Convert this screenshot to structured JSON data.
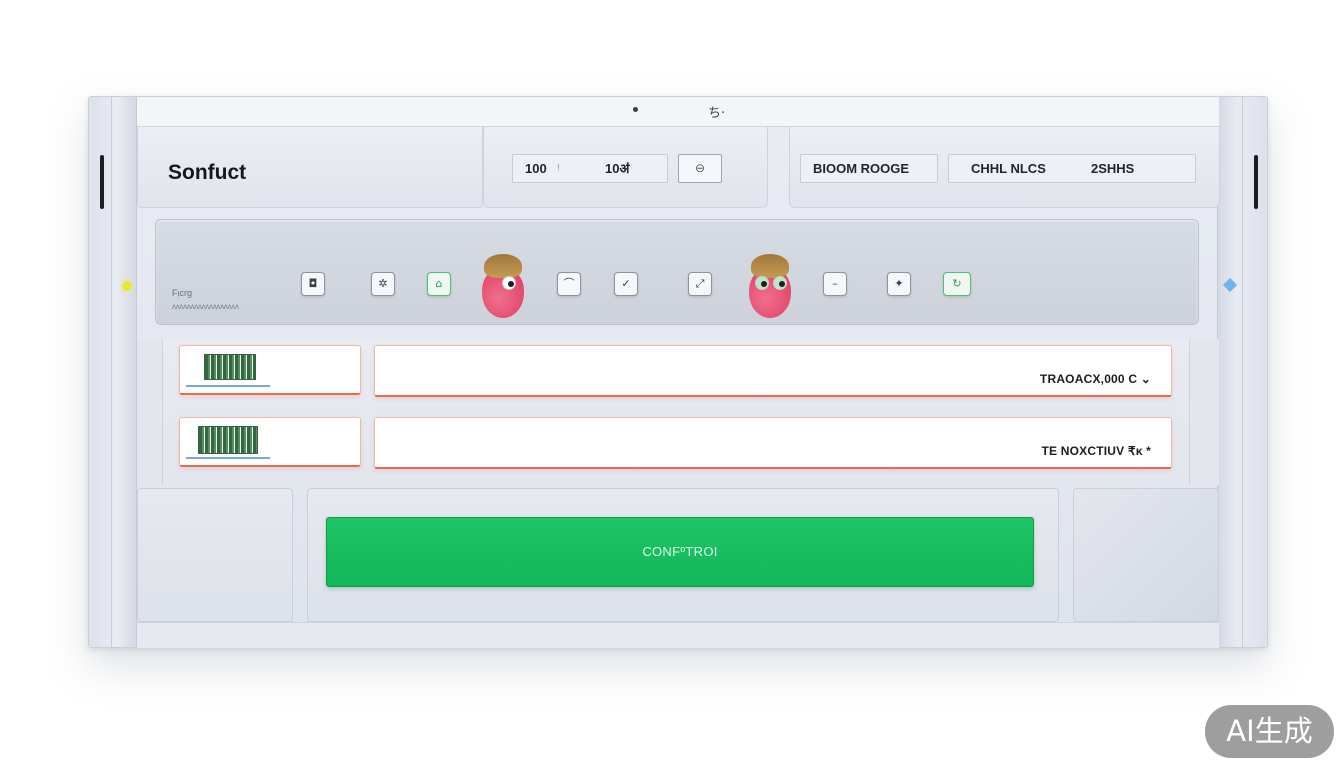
{
  "app": {
    "title": "Sonfuct"
  },
  "topbar": {
    "glyph": "ち·"
  },
  "zoom": {
    "value_a": "100",
    "separator": "!",
    "value_b": "10ॳ",
    "toggle_glyph": "⊖"
  },
  "mode": {
    "label": "BIOOM ROOGE"
  },
  "channel": {
    "label": "CHHL NLCS",
    "value": "2SHHS"
  },
  "controls": {
    "label_primary": "Fᴉcrg",
    "label_secondary": "ʌʌʌʌʌʌʌʌʌʌʌʌʌʌʌʌʌʌ",
    "buttons": [
      {
        "glyph": "◘",
        "accent": false
      },
      {
        "glyph": "✲",
        "accent": false
      },
      {
        "glyph": "⌂",
        "accent": true
      },
      {
        "glyph": "⌒",
        "accent": false
      },
      {
        "glyph": "✓",
        "accent": false
      },
      {
        "glyph": "⤢",
        "accent": false
      },
      {
        "glyph": "–",
        "accent": false
      },
      {
        "glyph": "✦",
        "accent": false
      },
      {
        "glyph": "↻",
        "accent": true
      }
    ]
  },
  "rows": [
    {
      "value": "TRAOACX,000 C ⌄"
    },
    {
      "value": "TE NOXCTIUV ₹ᴋ *"
    }
  ],
  "confirm": {
    "label": "CONFºTROI"
  },
  "watermark": {
    "text": "AI生成"
  },
  "colors": {
    "accent_green": "#13b75a",
    "row_border": "#ec6a4c",
    "mascot_pink": "#e0416a"
  }
}
